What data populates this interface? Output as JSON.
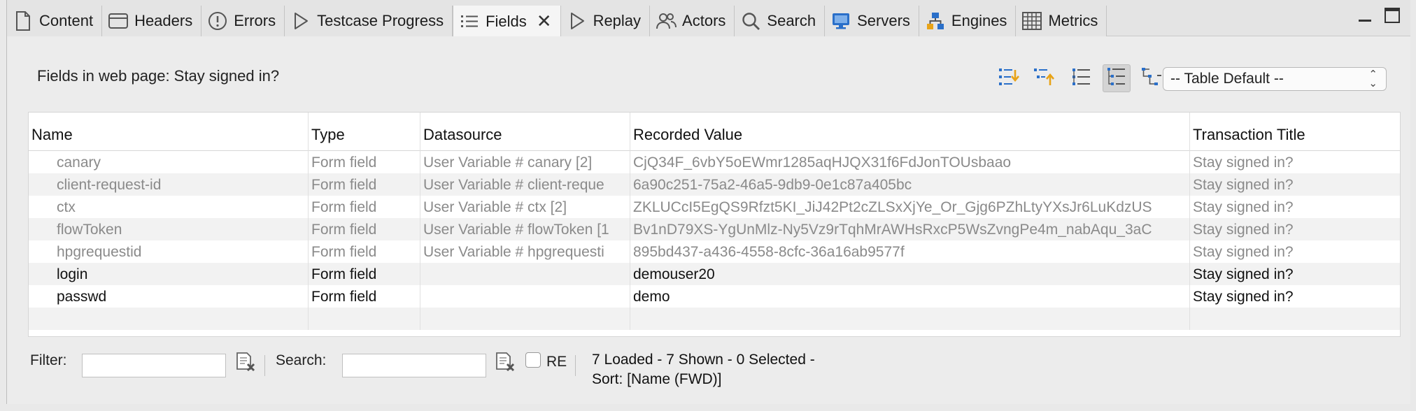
{
  "tabs": [
    {
      "label": "Content",
      "icon": "document-icon"
    },
    {
      "label": "Headers",
      "icon": "window-icon"
    },
    {
      "label": "Errors",
      "icon": "alert-icon"
    },
    {
      "label": "Testcase Progress",
      "icon": "play-icon"
    },
    {
      "label": "Fields",
      "icon": "list-icon",
      "active": true
    },
    {
      "label": "Replay",
      "icon": "play-icon"
    },
    {
      "label": "Actors",
      "icon": "users-icon"
    },
    {
      "label": "Search",
      "icon": "search-icon"
    },
    {
      "label": "Servers",
      "icon": "monitor-icon"
    },
    {
      "label": "Engines",
      "icon": "network-icon"
    },
    {
      "label": "Metrics",
      "icon": "grid-icon"
    }
  ],
  "panel": {
    "title": "Fields in web page: Stay signed in?",
    "view_select": "-- Table Default --"
  },
  "table": {
    "columns": [
      "Name",
      "Type",
      "Datasource",
      "Recorded Value",
      "Transaction Title"
    ],
    "rows": [
      {
        "name": "canary",
        "type": "Form field",
        "datasource": "User Variable # canary [2]",
        "value": "CjQ34F_6vbY5oEWmr1285aqHJQX31f6FdJonTOUsbaao",
        "title": "Stay signed in?",
        "dim": true
      },
      {
        "name": "client-request-id",
        "type": "Form field",
        "datasource": "User Variable # client-reque",
        "value": "6a90c251-75a2-46a5-9db9-0e1c87a405bc",
        "title": "Stay signed in?",
        "dim": true
      },
      {
        "name": "ctx",
        "type": "Form field",
        "datasource": "User Variable # ctx [2]",
        "value": "ZKLUCcI5EgQS9Rfzt5KI_JiJ42Pt2cZLSxXjYe_Or_Gjg6PZhLtyYXsJr6LuKdzUS",
        "title": "Stay signed in?",
        "dim": true
      },
      {
        "name": "flowToken",
        "type": "Form field",
        "datasource": "User Variable # flowToken [1",
        "value": "Bv1nD79XS-YgUnMlz-Ny5Vz9rTqhMrAWHsRxcP5WsZvngPe4m_nabAqu_3aC",
        "title": "Stay signed in?",
        "dim": true
      },
      {
        "name": "hpgrequestid",
        "type": "Form field",
        "datasource": "User Variable # hpgrequesti",
        "value": "895bd437-a436-4558-8cfc-36a16ab9577f",
        "title": "Stay signed in?",
        "dim": true
      },
      {
        "name": "login",
        "type": "Form field",
        "datasource": "",
        "value": "demouser20",
        "title": "Stay signed in?",
        "dim": false
      },
      {
        "name": "passwd",
        "type": "Form field",
        "datasource": "",
        "value": "demo",
        "title": "Stay signed in?",
        "dim": false
      }
    ]
  },
  "bottom": {
    "filter_label": "Filter:",
    "filter_value": "",
    "search_label": "Search:",
    "search_value": "",
    "re_label": "RE",
    "status_line1": "7 Loaded - 7 Shown - 0 Selected -",
    "status_line2": "Sort: [Name (FWD)]"
  },
  "colors": {
    "accent_blue": "#2a6fc9",
    "icon_orange": "#e8a317"
  }
}
